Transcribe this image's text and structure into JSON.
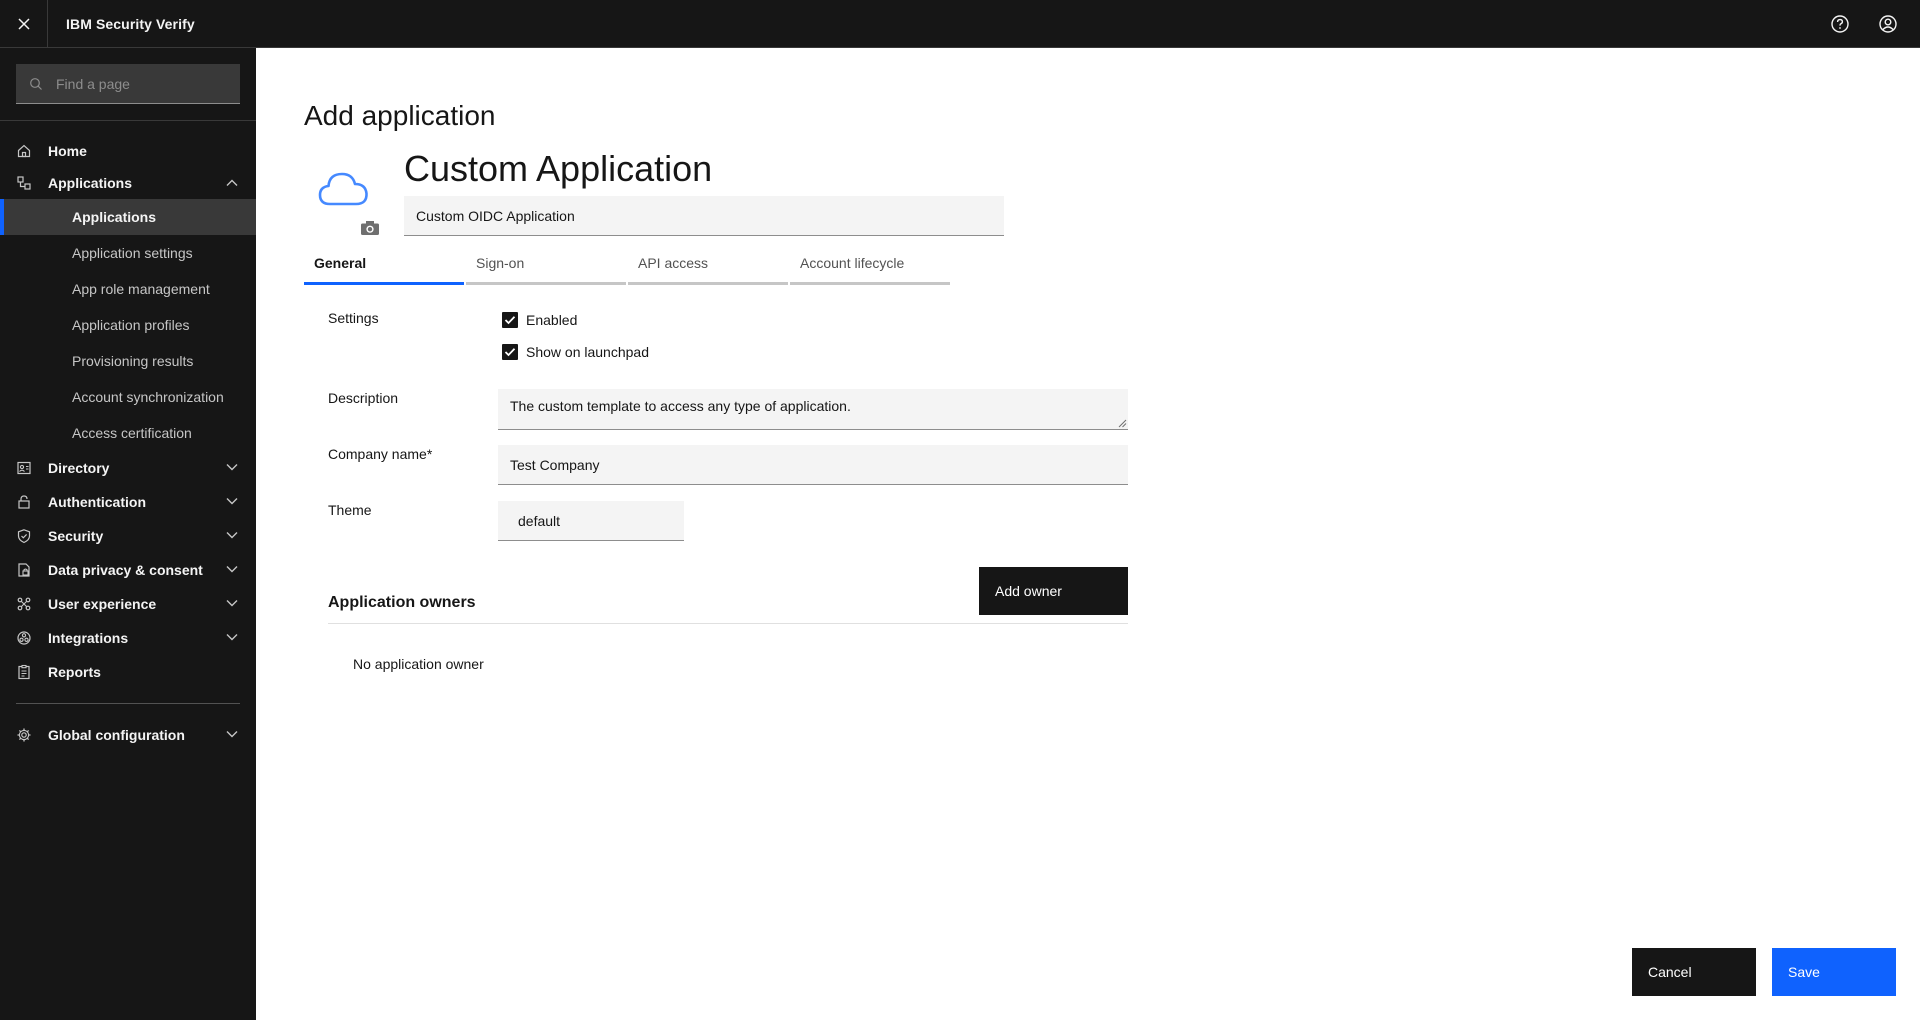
{
  "header": {
    "brand": "IBM Security Verify",
    "close_icon": "close-icon",
    "help_icon": "help-icon",
    "user_icon": "user-avatar-icon"
  },
  "sidebar": {
    "search_placeholder": "Find a page",
    "items": [
      {
        "label": "Home",
        "icon": "home-icon"
      },
      {
        "label": "Applications",
        "icon": "applications-icon",
        "expanded": true,
        "children": [
          {
            "label": "Applications",
            "active": true
          },
          {
            "label": "Application settings"
          },
          {
            "label": "App role management"
          },
          {
            "label": "Application profiles"
          },
          {
            "label": "Provisioning results"
          },
          {
            "label": "Account synchronization"
          },
          {
            "label": "Access certification"
          }
        ]
      },
      {
        "label": "Directory",
        "icon": "directory-icon"
      },
      {
        "label": "Authentication",
        "icon": "lock-icon"
      },
      {
        "label": "Security",
        "icon": "shield-icon"
      },
      {
        "label": "Data privacy & consent",
        "icon": "privacy-icon"
      },
      {
        "label": "User experience",
        "icon": "user-experience-icon"
      },
      {
        "label": "Integrations",
        "icon": "integrations-icon"
      },
      {
        "label": "Reports",
        "icon": "report-icon"
      }
    ],
    "global": {
      "label": "Global configuration",
      "icon": "gear-icon"
    }
  },
  "main": {
    "page_title": "Add application",
    "app_name": "Custom Application",
    "app_type": "Custom OIDC Application",
    "tabs": [
      {
        "label": "General",
        "active": true
      },
      {
        "label": "Sign-on"
      },
      {
        "label": "API access"
      },
      {
        "label": "Account lifecycle"
      }
    ],
    "form": {
      "settings_label": "Settings",
      "enabled_label": "Enabled",
      "enabled_checked": true,
      "launchpad_label": "Show on launchpad",
      "launchpad_checked": true,
      "description_label": "Description",
      "description_value": "The custom template to access any type of application.",
      "company_label": "Company name*",
      "company_value": "Test Company",
      "theme_label": "Theme",
      "theme_value": "default"
    },
    "owners": {
      "title": "Application owners",
      "add_button": "Add owner",
      "empty_text": "No application owner"
    },
    "actions": {
      "cancel": "Cancel",
      "save": "Save"
    }
  },
  "colors": {
    "header_bg": "#161616",
    "accent": "#0f62fe",
    "cloud_icon": "#4589ff"
  }
}
